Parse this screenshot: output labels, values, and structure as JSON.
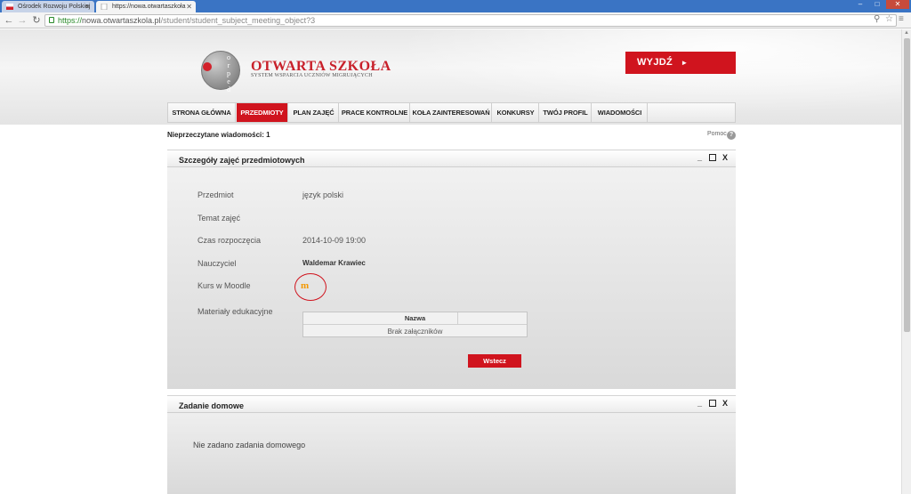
{
  "browser": {
    "tabs": [
      {
        "label": "Ośrodek Rozwoju Polskiej",
        "active": false
      },
      {
        "label": "https://nowa.otwartaszkoła",
        "active": true
      }
    ],
    "url_scheme": "https://",
    "url_host": "nowa.otwartaszkola.pl",
    "url_path": "/student/student_subject_meeting_object?3",
    "icons": {
      "back": "back-arrow-icon",
      "forward": "forward-arrow-icon",
      "reload": "reload-icon",
      "zoom": "zoom-icon",
      "star": "bookmark-star-icon",
      "menu": "menu-icon"
    }
  },
  "header": {
    "logo_letters": "o\nr\np\ne\nd",
    "title": "OTWARTA SZKOŁA",
    "subtitle": "SYSTEM WSPARCIA UCZNIÓW MIGRUJĄCYCH",
    "logout_label": "WYJDŹ",
    "logout_arrow": "►",
    "accent_color": "#d0141e"
  },
  "nav": {
    "items": [
      {
        "label": "STRONA GŁÓWNA",
        "active": false
      },
      {
        "label": "PRZEDMIOTY",
        "active": true
      },
      {
        "label": "PLAN ZAJĘĆ",
        "active": false
      },
      {
        "label": "PRACE KONTROLNE",
        "active": false
      },
      {
        "label": "KOŁA ZAINTERESOWAŃ",
        "active": false
      },
      {
        "label": "KONKURSY",
        "active": false
      },
      {
        "label": "TWÓJ PROFIL",
        "active": false
      },
      {
        "label": "WIADOMOŚCI",
        "active": false
      }
    ]
  },
  "status": {
    "unread": "Nieprzeczytane wiadomości: 1",
    "help_label": "Pomoc",
    "help_icon": "?"
  },
  "details_panel": {
    "title": "Szczegóły zajęć przedmiotowych",
    "controls": {
      "minimize": "_",
      "close": "X"
    },
    "rows": [
      {
        "label": "Przedmiot",
        "value": "język polski"
      },
      {
        "label": "Temat zajęć",
        "value": ""
      },
      {
        "label": "Czas rozpoczęcia",
        "value": "2014-10-09 19:00"
      },
      {
        "label": "Nauczyciel",
        "value": "Waldemar Krawiec"
      },
      {
        "label": "Kurs w Moodle",
        "value": ""
      },
      {
        "label": "Materiały edukacyjne",
        "value": ""
      }
    ],
    "moodle_icon": "m",
    "attachments": {
      "header": "Nazwa",
      "empty": "Brak załączników"
    },
    "back_label": "Wstecz"
  },
  "homework_panel": {
    "title": "Zadanie domowe",
    "controls": {
      "minimize": "_",
      "close": "X"
    },
    "text": "Nie zadano zadania domowego"
  }
}
